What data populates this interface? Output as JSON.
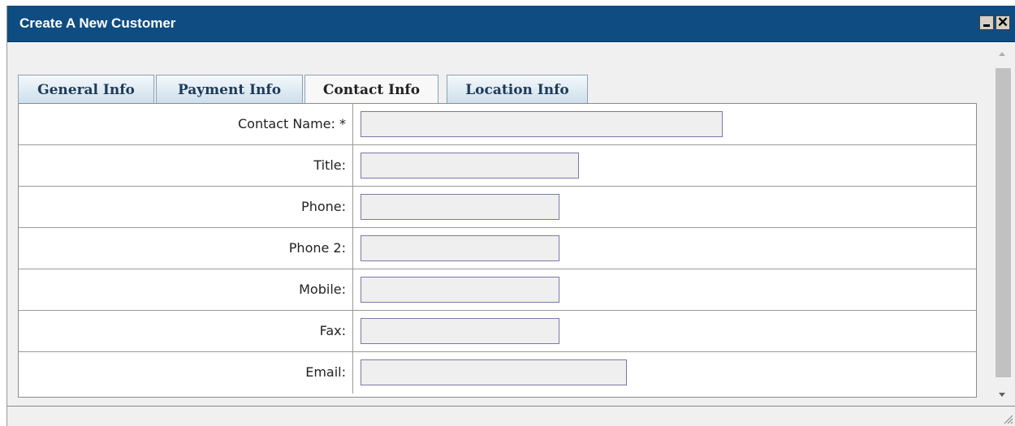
{
  "window": {
    "title": "Create A New Customer",
    "colors": {
      "titlebar": "#0f4c81",
      "background": "#f0f0f0"
    },
    "buttons": {
      "minimize": "minimize",
      "close": "close"
    }
  },
  "tabs": [
    {
      "label": "General Info",
      "active": false
    },
    {
      "label": "Payment Info",
      "active": false
    },
    {
      "label": "Contact Info",
      "active": true
    },
    {
      "label": "Location Info",
      "active": false
    }
  ],
  "form": {
    "rows": [
      {
        "label": "Contact Name: *",
        "value": ""
      },
      {
        "label": "Title:",
        "value": ""
      },
      {
        "label": "Phone:",
        "value": ""
      },
      {
        "label": "Phone 2:",
        "value": ""
      },
      {
        "label": "Mobile:",
        "value": ""
      },
      {
        "label": "Fax:",
        "value": ""
      },
      {
        "label": "Email:",
        "value": ""
      }
    ]
  },
  "icons": {
    "scroll_up": "arrow-up-icon",
    "scroll_down": "arrow-down-icon",
    "resize": "resize-grip-icon"
  }
}
